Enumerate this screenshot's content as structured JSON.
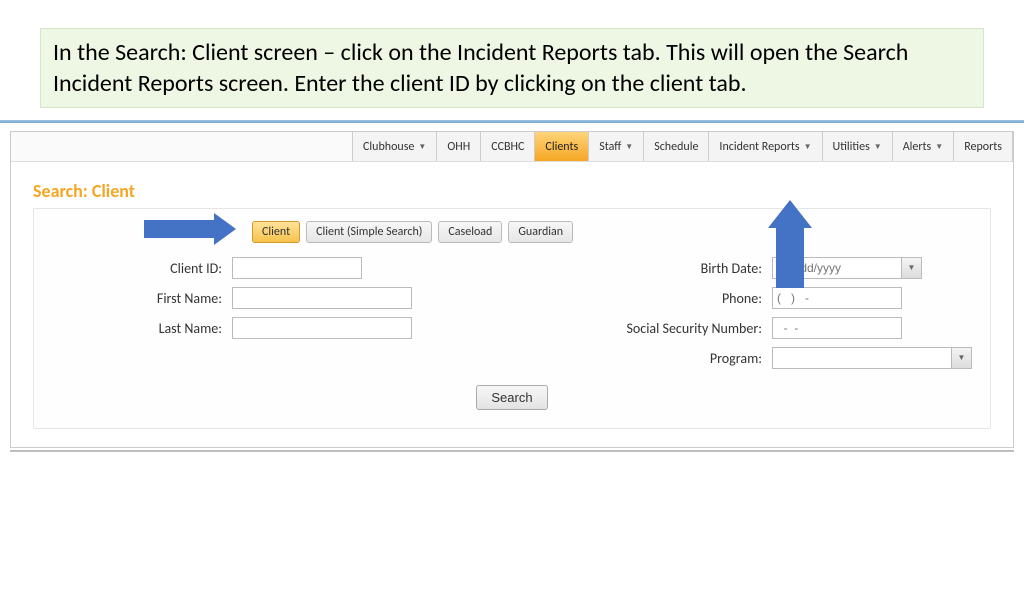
{
  "instruction": "In the Search: Client screen – click on the Incident Reports tab. This will open the Search Incident Reports screen. Enter the client ID by clicking on the client tab.",
  "nav": {
    "items": [
      {
        "label": "Clubhouse",
        "caret": true
      },
      {
        "label": "OHH"
      },
      {
        "label": "CCBHC"
      },
      {
        "label": "Clients",
        "active": true
      },
      {
        "label": "Staff",
        "caret": true
      },
      {
        "label": "Schedule"
      },
      {
        "label": "Incident Reports",
        "caret": true
      },
      {
        "label": "Utilities",
        "caret": true
      },
      {
        "label": "Alerts",
        "caret": true
      },
      {
        "label": "Reports"
      }
    ]
  },
  "page": {
    "title": "Search: Client"
  },
  "subtabs": {
    "items": [
      {
        "label": "Client",
        "active": true
      },
      {
        "label": "Client (Simple Search)"
      },
      {
        "label": "Caseload"
      },
      {
        "label": "Guardian"
      }
    ]
  },
  "form": {
    "left": {
      "clientId": {
        "label": "Client ID:",
        "value": ""
      },
      "firstName": {
        "label": "First Name:",
        "value": ""
      },
      "lastName": {
        "label": "Last Name:",
        "value": ""
      }
    },
    "right": {
      "birthDate": {
        "label": "Birth Date:",
        "placeholder": "MM/dd/yyyy"
      },
      "phone": {
        "label": "Phone:",
        "placeholder": "(   )   -"
      },
      "ssn": {
        "label": "Social Security Number:",
        "placeholder": "  -  -"
      },
      "program": {
        "label": "Program:",
        "value": ""
      }
    },
    "searchLabel": "Search"
  }
}
